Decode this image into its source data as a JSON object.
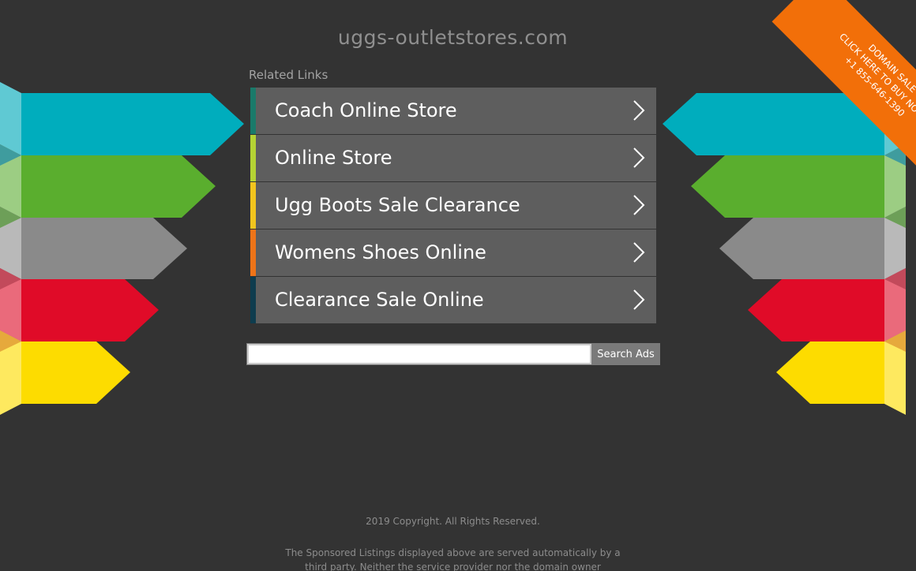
{
  "header": {
    "domain": "uggs-outletstores.com",
    "related_label": "Related Links"
  },
  "links": [
    {
      "label": "Coach Online Store",
      "accent": "#1a7a6a"
    },
    {
      "label": "Online Store",
      "accent": "#b5d334"
    },
    {
      "label": "Ugg Boots Sale Clearance",
      "accent": "#f2c51e"
    },
    {
      "label": "Womens Shoes Online",
      "accent": "#ee7419"
    },
    {
      "label": "Clearance Sale Online",
      "accent": "#0e3c4e"
    }
  ],
  "search": {
    "placeholder": "",
    "value": "",
    "button_label": "Search Ads"
  },
  "ribbon": {
    "line1": "DOMAIN SALE",
    "line2": "CLICK HERE TO BUY NOW!",
    "line3": "+1 855-646-1390",
    "color": "#f26f09"
  },
  "footer": {
    "copyright": "2019 Copyright. All Rights Reserved.",
    "disclaimer": "The Sponsored Listings displayed above are served automatically by a third party. Neither the service provider nor the domain owner"
  },
  "icons": {
    "link_chevron": "chevron-right-icon"
  },
  "colors": {
    "background": "#333333",
    "link_bg": "#5e5e5e",
    "arrow_teal": "#00adbd",
    "arrow_green": "#5aae2e",
    "arrow_gray": "#8a8a8a",
    "arrow_red": "#e00b28",
    "arrow_yellow": "#fddc00"
  }
}
